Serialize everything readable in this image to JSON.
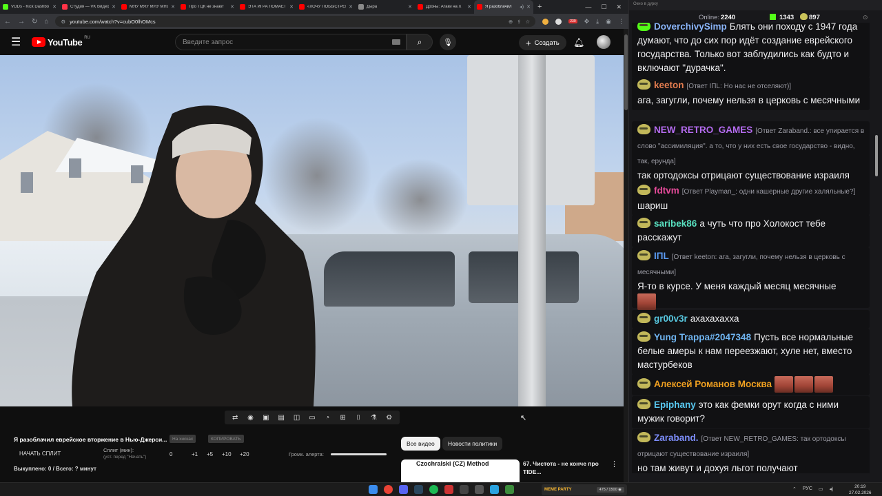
{
  "browser": {
    "tabs": [
      {
        "label": "VODs - Kick Dashbo",
        "color": "#53fc18",
        "active": false
      },
      {
        "label": "Студия — VK Видео",
        "color": "#ff3347",
        "active": false
      },
      {
        "label": "МЯУ МЯУ МЯУ МЯУ",
        "color": "#ff0000",
        "active": false
      },
      {
        "label": "Про ТЦК не знают",
        "color": "#ff0000",
        "active": false
      },
      {
        "label": "ЭТА ИГРА ЛОМАЕТ",
        "color": "#ff0000",
        "active": false
      },
      {
        "label": "«ХОЧУ ПОБЫСТРЕЕ",
        "color": "#ff0000",
        "active": false
      },
      {
        "label": "Дыра",
        "color": "#8a8a8a",
        "active": false
      },
      {
        "label": "Дроны: Атаки на Х",
        "color": "#ff0000",
        "active": false
      },
      {
        "label": "Я разоблачил",
        "color": "#ff0000",
        "active": true
      }
    ],
    "new_tab": "+",
    "url": "youtube.com/watch?v=cubO0lhOMcs",
    "win_minimize": "—",
    "win_maximize": "☐",
    "win_close": "✕",
    "ext_badge": "239"
  },
  "youtube": {
    "logo_text": "YouTube",
    "logo_region": "RU",
    "search_placeholder": "Введите запрос",
    "create_label": "Создать",
    "video_title": "Я разоблачил еврейское вторжение в Нью-Джерси...",
    "chips": [
      "Все видео",
      "Новости политики"
    ],
    "recommendation": {
      "thumb_title": "Czochralski (CZ) Method",
      "title": "67. Чистота - не конче про TIDE..."
    }
  },
  "tracker": {
    "btn_tag1": "На хисках",
    "btn_tag2": "КОПИРОВАТЬ",
    "split_button": "НАЧАТЬ СПЛИТ",
    "split_label": "Сплит (мин):",
    "split_hint": "(уст. перед \"Начать\")",
    "split_value": "0",
    "increments": [
      "+1",
      "+5",
      "+10",
      "+20"
    ],
    "alert_label": "Громк. алерта:",
    "alert_level": 1.0,
    "bought": "Выкуплено: 0 / Всего: ? минут"
  },
  "chat": {
    "window_title": "Окно в дурку",
    "online_label": "Online:",
    "online_count": "2240",
    "kick_count": "1343",
    "pepe_count": "897",
    "messages": [
      {
        "user": "DoverchivySimp",
        "color": "#8ab4f8",
        "reply": "",
        "text": "Блять они походу с 1947 года думают, что до сих пор идёт создание еврейского государства. Только вот заблудились как будто и включают \"дурачка\"."
      },
      {
        "user": "keeton",
        "color": "#e67e50",
        "reply": "[Ответ IПL: Но нас не отселяют)]",
        "text": "ага, загугли, почему нельзя в церковь с месячными"
      },
      {
        "user": "NEW_RETRO_GAMES",
        "color": "#b56cf0",
        "reply": "[Ответ Zaraband.: все упирается в слово \"ассимиляция\". а то, что у них есть свое государство - видно, так, ерунда]",
        "text": "так ортодоксы отрицают существование израиля"
      },
      {
        "user": "fdtvm",
        "color": "#e64b9a",
        "reply": "[Ответ Playman_: одни кашерные другие халяльные?]",
        "text": "шариш"
      },
      {
        "user": "saribek86",
        "color": "#58e0c0",
        "reply": "",
        "text": "а чуть что про Холокост тебе расскажут"
      },
      {
        "user": "IПL",
        "color": "#5b9bf2",
        "reply": "[Ответ keeton: ага, загугли, почему нельзя в церковь с месячными]",
        "text": "Я-то в курсе. У меня каждый месяц месячные"
      },
      {
        "user": "gr00v3r",
        "color": "#58c8e0",
        "reply": "",
        "text": "ахахахахха"
      },
      {
        "user": "Yung Trappa#2047348",
        "color": "#6fb4f0",
        "reply": "",
        "text": "Пусть все нормальные белые амеры к нам переезжают, хуле нет, вместо мастурбеков"
      },
      {
        "user": "Алексей Романов Москва",
        "color": "#f0a020",
        "reply": "",
        "text": ""
      },
      {
        "user": "Epiphany",
        "color": "#58c8f0",
        "reply": "",
        "text": "это как фемки орут когда с ними мужик говорит?"
      },
      {
        "user": "Zaraband.",
        "color": "#7c8cf8",
        "reply": "[Ответ NEW_RETRO_GAMES: так ортодоксы отрицают существование израиля]",
        "text": "но там живут и дохуя льгот получают"
      }
    ]
  },
  "taskbar": {
    "meme_party_label": "MEME PARTY",
    "meme_counter": "475 / 1500 ◉",
    "lang": "РУС",
    "time": "20:19",
    "date": "27.02.2026"
  },
  "colors": {
    "yt_red": "#ff0000",
    "kick_green": "#53fc18",
    "chat_bg": "#18181b"
  }
}
